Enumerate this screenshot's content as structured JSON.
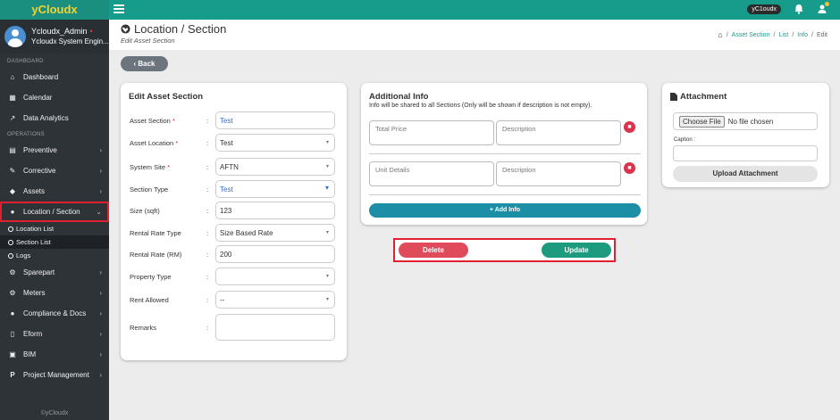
{
  "app": {
    "brand": "yCloudx",
    "user_pill": "yC1oudx"
  },
  "profile": {
    "name": "Ycloudx_Admin",
    "role": "Ycloudx System Engin..."
  },
  "sidebar": {
    "section_dashboard": "DASHBOARD",
    "section_operations": "OPERATIONS",
    "items": [
      {
        "label": "Dashboard"
      },
      {
        "label": "Calendar"
      },
      {
        "label": "Data Analytics"
      },
      {
        "label": "Preventive"
      },
      {
        "label": "Corrective"
      },
      {
        "label": "Assets"
      },
      {
        "label": "Location / Section"
      },
      {
        "label": "Sparepart"
      },
      {
        "label": "Meters"
      },
      {
        "label": "Compliance & Docs"
      },
      {
        "label": "Eform"
      },
      {
        "label": "BIM"
      },
      {
        "label": "Project Management"
      }
    ],
    "sub_items": [
      {
        "label": "Location List"
      },
      {
        "label": "Section List"
      },
      {
        "label": "Logs"
      }
    ],
    "footer": "©yCloudx"
  },
  "header": {
    "title": "Location / Section",
    "subtitle": "Edit Asset Section",
    "breadcrumb": [
      "Asset Section",
      "List",
      "Info",
      "Edit"
    ]
  },
  "back_label": "Back",
  "edit_form": {
    "title": "Edit Asset Section",
    "fields": [
      {
        "label": "Asset Section",
        "required": true,
        "value": "Test"
      },
      {
        "label": "Asset Location",
        "required": true,
        "value": "Test"
      },
      {
        "label": "System Site",
        "required": true,
        "value": "AFTN"
      },
      {
        "label": "Section Type",
        "required": false,
        "value": "Test"
      },
      {
        "label": "Size (sqft)",
        "required": false,
        "value": "123"
      },
      {
        "label": "Rental Rate Type",
        "required": false,
        "value": "Size Based Rate"
      },
      {
        "label": "Rental Rate (RM)",
        "required": false,
        "value": "200"
      },
      {
        "label": "Property Type",
        "required": false,
        "value": ""
      },
      {
        "label": "Rent Allowed",
        "required": false,
        "value": "--"
      },
      {
        "label": "Remarks",
        "required": false,
        "value": ""
      }
    ],
    "required_mark": "*",
    "colon": ":"
  },
  "additional_info": {
    "title": "Additional Info",
    "note": "Info will be shared to all Sections (Only will be shown if description is not empty).",
    "rows": [
      {
        "name_placeholder": "Total Price",
        "desc_placeholder": "Description"
      },
      {
        "name_placeholder": "Unit Details",
        "desc_placeholder": "Description"
      }
    ],
    "add_label": "Add Info"
  },
  "actions": {
    "delete_label": "Delete",
    "update_label": "Update"
  },
  "attachment": {
    "title": "Attachment",
    "choose_label": "Choose File",
    "no_file": "No file chosen",
    "caption_label": "Caption :",
    "upload_label": "Upload Attachment"
  },
  "colors": {
    "topbar": "#179b8a",
    "sidebar": "#2e3338",
    "brand_text": "#f5d22e",
    "highlight_border": "#e0202e",
    "delete": "#e04b5c",
    "update": "#1d9b7f",
    "add_info": "#1c8fa6"
  }
}
